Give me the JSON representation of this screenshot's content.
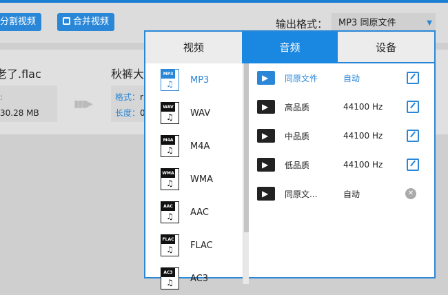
{
  "toolbar": {
    "split_label": "分割视频",
    "merge_label": "合并视频",
    "format_label": "输出格式：",
    "format_value": "MP3  同原文件"
  },
  "files": [
    {
      "name": "老了.flac",
      "info": [
        ":",
        "30.28 MB"
      ]
    },
    {
      "name": "秋裤大",
      "format_key": "格式：",
      "format_val": "r",
      "length_key": "长度：",
      "length_val": "0"
    }
  ],
  "popup": {
    "tabs": [
      "视频",
      "音频",
      "设备"
    ],
    "active_tab": "音频",
    "formats": [
      {
        "tag": "MP3",
        "label": "MP3",
        "selected": true
      },
      {
        "tag": "WAV",
        "label": "WAV"
      },
      {
        "tag": "M4A",
        "label": "M4A"
      },
      {
        "tag": "WMA",
        "label": "WMA"
      },
      {
        "tag": "AAC",
        "label": "AAC"
      },
      {
        "tag": "FLAC",
        "label": "FLAC"
      },
      {
        "tag": "AC3",
        "label": "AC3"
      }
    ],
    "presets": [
      {
        "name": "同原文件",
        "value": "自动",
        "action": "edit",
        "selected": true
      },
      {
        "name": "高品质",
        "value": "44100 Hz",
        "action": "edit"
      },
      {
        "name": "中品质",
        "value": "44100 Hz",
        "action": "edit"
      },
      {
        "name": "低品质",
        "value": "44100 Hz",
        "action": "edit"
      },
      {
        "name": "同原文...",
        "value": "自动",
        "action": "delete"
      }
    ],
    "scroll_position": 0
  },
  "colors": {
    "accent": "#2a87d8"
  }
}
